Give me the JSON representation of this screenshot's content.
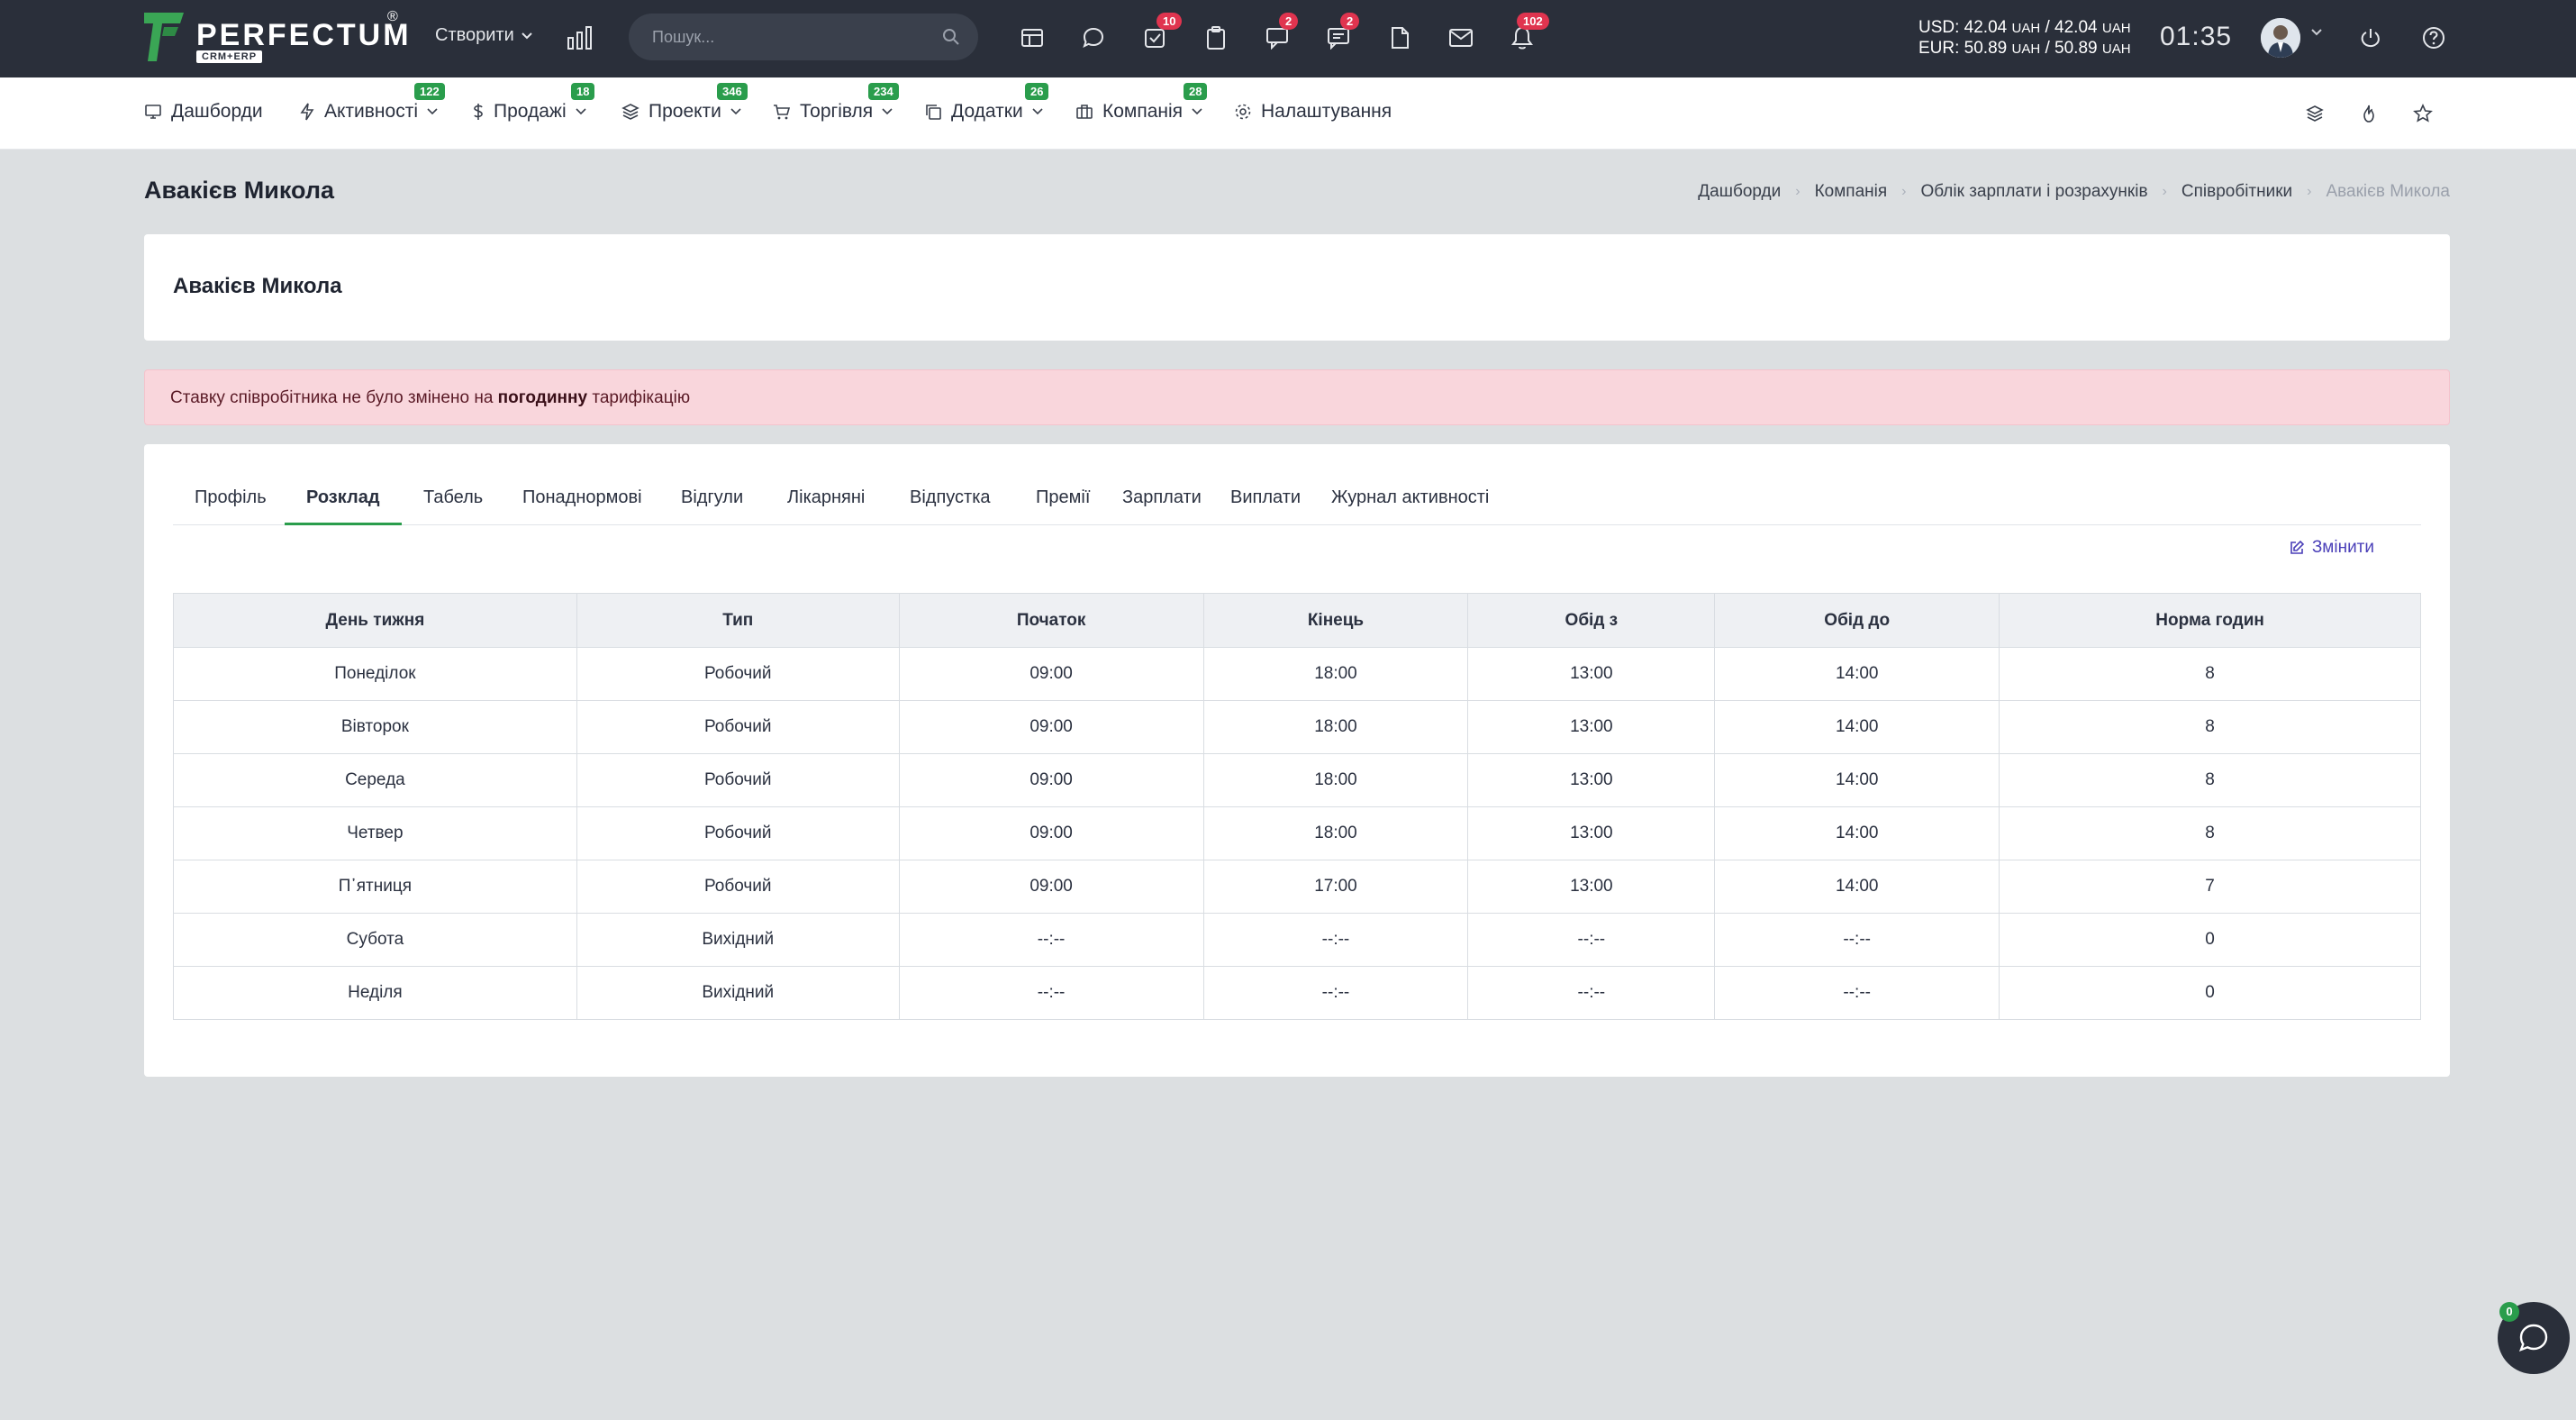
{
  "topbar": {
    "logo_text": "PERFECTUM",
    "logo_reg": "®",
    "logo_sub": "CRM+ERP",
    "create_label": "Створити",
    "search_placeholder": "Пошук...",
    "badges": {
      "tasks": "10",
      "chat": "2",
      "messages": "2",
      "notifications": "102"
    },
    "currency": {
      "usd": "USD: 42.04",
      "usd_unit1": "UAH",
      "usd_sep": "/ 42.04",
      "usd_unit2": "UAH",
      "eur": "EUR: 50.89",
      "eur_unit1": "UAH",
      "eur_sep": "/ 50.89",
      "eur_unit2": "UAH"
    },
    "clock": "01:35"
  },
  "nav": {
    "items": [
      {
        "label": "Дашборди",
        "badge": ""
      },
      {
        "label": "Активності",
        "badge": "122"
      },
      {
        "label": "Продажі",
        "badge": "18"
      },
      {
        "label": "Проекти",
        "badge": "346"
      },
      {
        "label": "Торгівля",
        "badge": "234"
      },
      {
        "label": "Додатки",
        "badge": "26"
      },
      {
        "label": "Компанія",
        "badge": "28"
      },
      {
        "label": "Налаштування",
        "badge": ""
      }
    ]
  },
  "page": {
    "title": "Авакієв Микола",
    "breadcrumb": [
      "Дашборди",
      "Компанія",
      "Облік зарплати і розрахунків",
      "Співробітники",
      "Авакієв Микола"
    ],
    "card_title": "Авакієв Микола",
    "alert_before": "Ставку співробітника не було змінено на ",
    "alert_bold": "погодинну",
    "alert_after": " тарифікацію"
  },
  "tabs": [
    "Профіль",
    "Розклад",
    "Табель",
    "Понаднормові",
    "Відгули",
    "Лікарняні",
    "Відпустка",
    "Премії",
    "Зарплати",
    "Виплати",
    "Журнал активності"
  ],
  "active_tab": "Розклад",
  "edit_label": "Змінити",
  "schedule": {
    "headers": [
      "День тижня",
      "Тип",
      "Початок",
      "Кінець",
      "Обід з",
      "Обід до",
      "Норма годин"
    ],
    "rows": [
      [
        "Понеділок",
        "Робочий",
        "09:00",
        "18:00",
        "13:00",
        "14:00",
        "8"
      ],
      [
        "Вівторок",
        "Робочий",
        "09:00",
        "18:00",
        "13:00",
        "14:00",
        "8"
      ],
      [
        "Середа",
        "Робочий",
        "09:00",
        "18:00",
        "13:00",
        "14:00",
        "8"
      ],
      [
        "Четвер",
        "Робочий",
        "09:00",
        "18:00",
        "13:00",
        "14:00",
        "8"
      ],
      [
        "П᾽ятниця",
        "Робочий",
        "09:00",
        "17:00",
        "13:00",
        "14:00",
        "7"
      ],
      [
        "Субота",
        "Вихідний",
        "--:--",
        "--:--",
        "--:--",
        "--:--",
        "0"
      ],
      [
        "Неділя",
        "Вихідний",
        "--:--",
        "--:--",
        "--:--",
        "--:--",
        "0"
      ]
    ]
  },
  "chat_fab_badge": "0",
  "colors": {
    "topbar": "#2a2f3a",
    "accent_green": "#2a9d4c",
    "badge_red": "#e0344f",
    "alert_bg": "#f9d6dc",
    "link_purple": "#4a3fb8"
  }
}
